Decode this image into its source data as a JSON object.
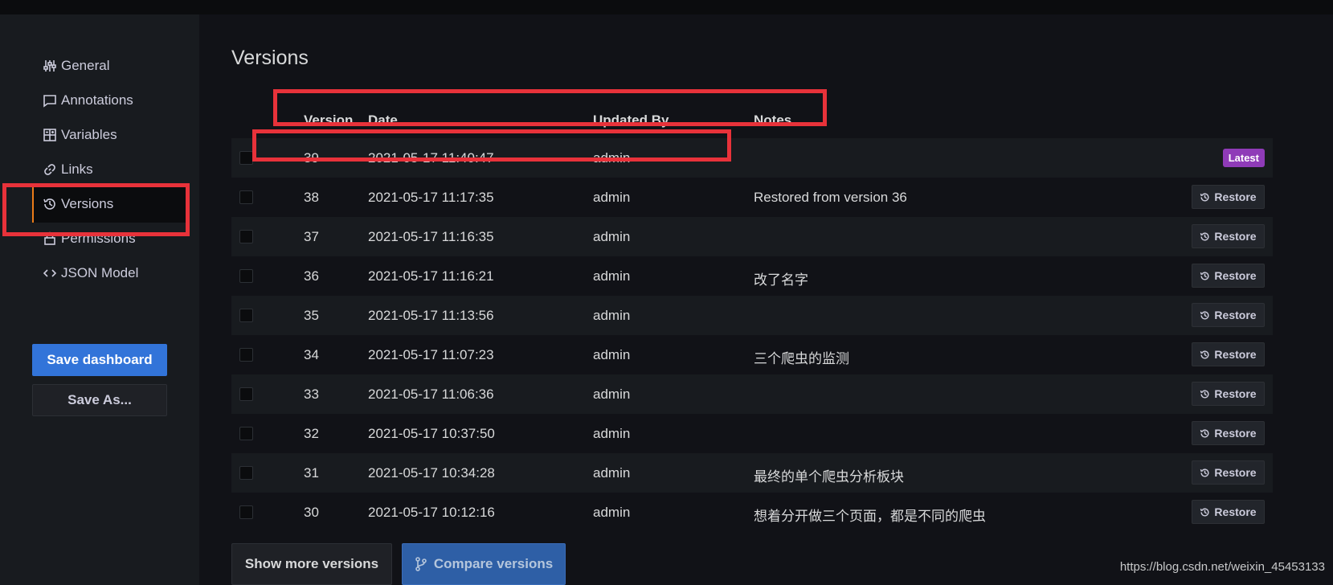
{
  "sidebar": {
    "items": [
      {
        "label": "General",
        "icon": "sliders-icon"
      },
      {
        "label": "Annotations",
        "icon": "comment-icon"
      },
      {
        "label": "Variables",
        "icon": "calculator-icon"
      },
      {
        "label": "Links",
        "icon": "link-icon"
      },
      {
        "label": "Versions",
        "icon": "history-icon",
        "active": true
      },
      {
        "label": "Permissions",
        "icon": "lock-icon"
      },
      {
        "label": "JSON Model",
        "icon": "code-icon"
      }
    ],
    "save_dashboard_label": "Save dashboard",
    "save_as_label": "Save As..."
  },
  "main": {
    "title": "Versions",
    "columns": [
      "Version",
      "Date",
      "Updated By",
      "Notes"
    ],
    "rows": [
      {
        "version": "39",
        "date": "2021-05-17 11:40:47",
        "updated_by": "admin",
        "notes": "",
        "badge": "Latest"
      },
      {
        "version": "38",
        "date": "2021-05-17 11:17:35",
        "updated_by": "admin",
        "notes": "Restored from version 36",
        "action": "Restore"
      },
      {
        "version": "37",
        "date": "2021-05-17 11:16:35",
        "updated_by": "admin",
        "notes": "",
        "action": "Restore"
      },
      {
        "version": "36",
        "date": "2021-05-17 11:16:21",
        "updated_by": "admin",
        "notes": "改了名字",
        "action": "Restore"
      },
      {
        "version": "35",
        "date": "2021-05-17 11:13:56",
        "updated_by": "admin",
        "notes": "",
        "action": "Restore"
      },
      {
        "version": "34",
        "date": "2021-05-17 11:07:23",
        "updated_by": "admin",
        "notes": "三个爬虫的监测",
        "action": "Restore"
      },
      {
        "version": "33",
        "date": "2021-05-17 11:06:36",
        "updated_by": "admin",
        "notes": "",
        "action": "Restore"
      },
      {
        "version": "32",
        "date": "2021-05-17 10:37:50",
        "updated_by": "admin",
        "notes": "",
        "action": "Restore"
      },
      {
        "version": "31",
        "date": "2021-05-17 10:34:28",
        "updated_by": "admin",
        "notes": "最终的单个爬虫分析板块",
        "action": "Restore"
      },
      {
        "version": "30",
        "date": "2021-05-17 10:12:16",
        "updated_by": "admin",
        "notes": "想着分开做三个页面，都是不同的爬虫",
        "action": "Restore"
      }
    ],
    "show_more_label": "Show more versions",
    "compare_label": "Compare versions"
  },
  "watermark": "https://blog.csdn.net/weixin_45453133",
  "colors": {
    "background": "#111217",
    "sidebar": "#181b1f",
    "primary": "#3274d9",
    "latest_badge": "#8f3bb8",
    "active_indicator": "#eb7b18",
    "highlight": "#e8323a"
  }
}
